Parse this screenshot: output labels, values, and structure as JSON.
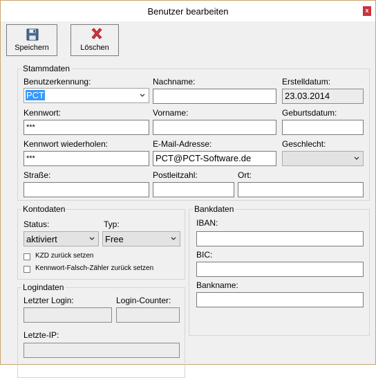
{
  "window": {
    "title": "Benutzer bearbeiten",
    "close_label": "x"
  },
  "toolbar": {
    "save_label": "Speichern",
    "delete_label": "Löschen"
  },
  "stammdaten": {
    "legend": "Stammdaten",
    "benutzerkennung_label": "Benutzerkennung:",
    "benutzerkennung_value": "PCT",
    "nachname_label": "Nachname:",
    "nachname_value": "",
    "erstelldatum_label": "Erstelldatum:",
    "erstelldatum_value": "23.03.2014",
    "kennwort_label": "Kennwort:",
    "kennwort_value": "***",
    "vorname_label": "Vorname:",
    "vorname_value": "",
    "geburtsdatum_label": "Geburtsdatum:",
    "geburtsdatum_value": "",
    "kennwort_wdh_label": "Kennwort wiederholen:",
    "kennwort_wdh_value": "***",
    "email_label": "E-Mail-Adresse:",
    "email_value": "PCT@PCT-Software.de",
    "geschlecht_label": "Geschlecht:",
    "geschlecht_value": "",
    "strasse_label": "Straße:",
    "strasse_value": "",
    "plz_label": "Postleitzahl:",
    "plz_value": "",
    "ort_label": "Ort:",
    "ort_value": ""
  },
  "kontodaten": {
    "legend": "Kontodaten",
    "status_label": "Status:",
    "status_value": "aktiviert",
    "typ_label": "Typ:",
    "typ_value": "Free",
    "kzd_label": "KZD zurück setzen",
    "kennwort_falsch_label": "Kennwort-Falsch-Zähler zurück setzen"
  },
  "logindaten": {
    "legend": "Logindaten",
    "letzter_login_label": "Letzter Login:",
    "letzter_login_value": "",
    "login_counter_label": "Login-Counter:",
    "login_counter_value": "",
    "letzte_ip_label": "Letzte-IP:",
    "letzte_ip_value": ""
  },
  "bankdaten": {
    "legend": "Bankdaten",
    "iban_label": "IBAN:",
    "iban_value": "",
    "bic_label": "BIC:",
    "bic_value": "",
    "bankname_label": "Bankname:",
    "bankname_value": ""
  }
}
